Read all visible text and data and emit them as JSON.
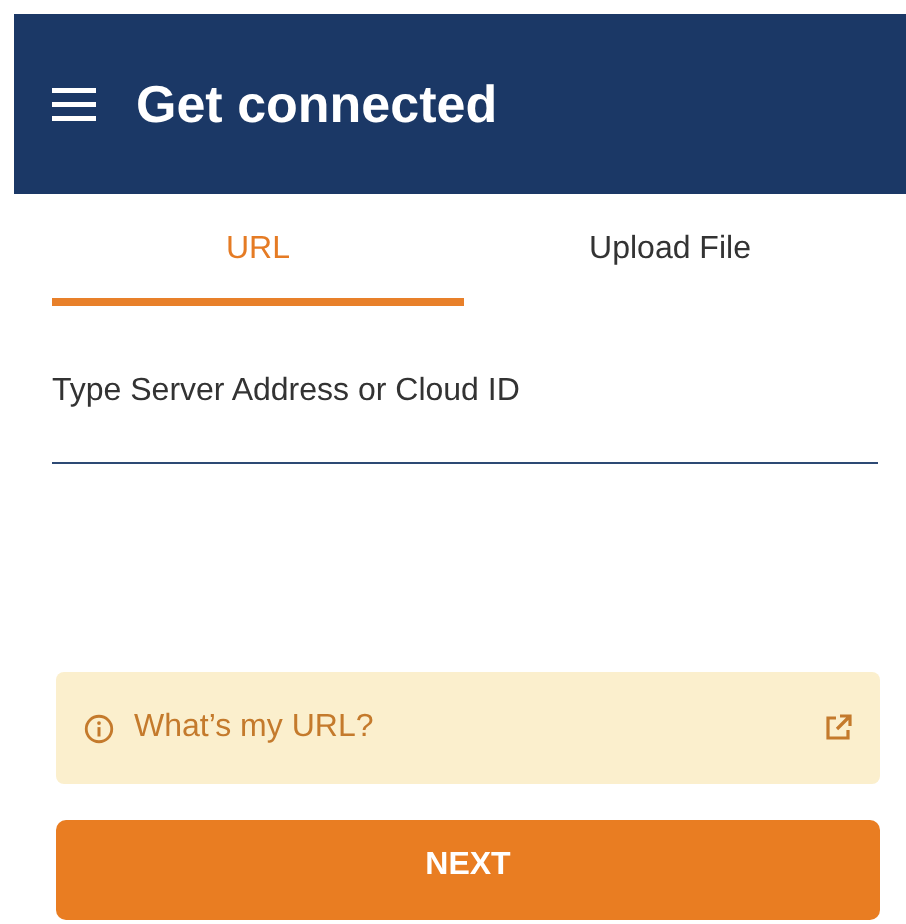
{
  "header": {
    "title": "Get connected"
  },
  "tabs": [
    {
      "label": "URL",
      "selected": true
    },
    {
      "label": "Upload File",
      "selected": false
    }
  ],
  "field": {
    "placeholder": "Type Server Address or Cloud ID"
  },
  "help_banner": {
    "label": "What’s my URL?"
  },
  "buttons": [
    {
      "label": "NEXT"
    }
  ]
}
